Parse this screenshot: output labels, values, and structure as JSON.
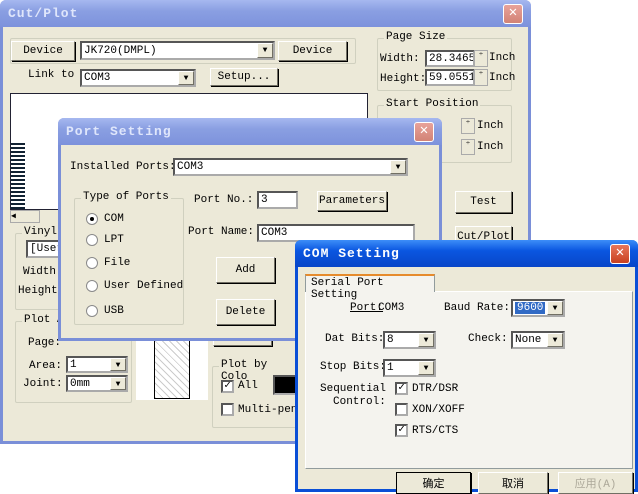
{
  "cutplot": {
    "title": "Cut/Plot",
    "device_btn": "Device",
    "device_combo": "JK720(DMPL)",
    "device_btn2": "Device",
    "link_to": "Link to",
    "link_combo": "COM3",
    "setup": "Setup...",
    "page_size": {
      "label": "Page Size",
      "width_label": "Width:",
      "width": "28.3465",
      "height_label": "Height:",
      "height": "59.0551",
      "unit": "Inch"
    },
    "start_position": {
      "label": "Start Position",
      "unit": "Inch"
    },
    "test": "Test",
    "cutplot_btn": "Cut/Plot",
    "vinyl": {
      "label": "Vinyl",
      "combo": "[User",
      "width": "Width:",
      "height": "Height:"
    },
    "plot_area": {
      "label": "Plot A",
      "page": "Page:",
      "area": "Area:",
      "area_val": "1",
      "joint": "Joint:",
      "joint_val": "0mm"
    },
    "plot_by_color": {
      "label": "Plot by Colo",
      "all": "All",
      "multi": "Multi-pen"
    }
  },
  "port": {
    "title": "Port Setting",
    "installed_label": "Installed Ports:",
    "installed": "COM3",
    "type_label": "Type of Ports",
    "types": [
      "COM",
      "LPT",
      "File",
      "User Defined",
      "USB"
    ],
    "port_no_label": "Port No.:",
    "port_no": "3",
    "parameters": "Parameters",
    "port_name_label": "Port Name:",
    "port_name": "COM3",
    "add": "Add",
    "delete": "Delete"
  },
  "com": {
    "title": "COM Setting",
    "tab": "Serial Port Setting",
    "port_label": "Port:",
    "port": "COM3",
    "baud_label": "Baud Rate:",
    "baud": "9600",
    "dat_label": "Dat Bits:",
    "dat": "8",
    "check_label": "Check:",
    "check": "None",
    "stop_label": "Stop Bits:",
    "stop": "1",
    "seq1": "Sequential",
    "seq2": "Control:",
    "dtr": "DTR/DSR",
    "xon": "XON/XOFF",
    "rts": "RTS/CTS",
    "ok": "确定",
    "cancel": "取消",
    "apply": "应用(A)"
  }
}
